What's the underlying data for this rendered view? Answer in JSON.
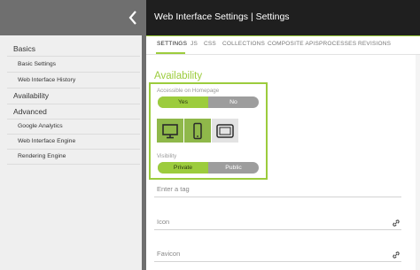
{
  "header": {
    "title": "Web Interface Settings | Settings"
  },
  "sidebar": {
    "items": [
      {
        "label": "Basics"
      },
      {
        "label": "Basic Settings"
      },
      {
        "label": "Web Interface History"
      },
      {
        "label": "Availability"
      },
      {
        "label": "Advanced"
      },
      {
        "label": "Google Analytics"
      },
      {
        "label": "Web Interface Engine"
      },
      {
        "label": "Rendering Engine"
      }
    ]
  },
  "tabs": [
    {
      "label": "SETTINGS",
      "active": true
    },
    {
      "label": "JS"
    },
    {
      "label": "CSS"
    },
    {
      "label": "COLLECTIONS"
    },
    {
      "label": "COMPOSITE APIS"
    },
    {
      "label": "PROCESSES"
    },
    {
      "label": "REVISIONS"
    }
  ],
  "main": {
    "section_title": "Availability",
    "homepage": {
      "label": "Accessible on Homepage",
      "options": [
        "Yes",
        "No"
      ],
      "selected": "Yes"
    },
    "devices": [
      {
        "icon": "desktop-icon",
        "selected": true
      },
      {
        "icon": "phone-icon",
        "selected": true
      },
      {
        "icon": "tablet-icon",
        "selected": false
      }
    ],
    "visibility": {
      "label": "Visibility",
      "options": [
        "Private",
        "Public"
      ],
      "selected": "Private"
    },
    "tag_placeholder": "Enter a tag",
    "icon_label": "Icon",
    "favicon_label": "Favicon"
  },
  "colors": {
    "accent": "#9ccc3d",
    "topbar_dark": "#1f1f1f",
    "topbar_gray": "#6f6f6f",
    "sidebar_bg": "#efefef"
  }
}
